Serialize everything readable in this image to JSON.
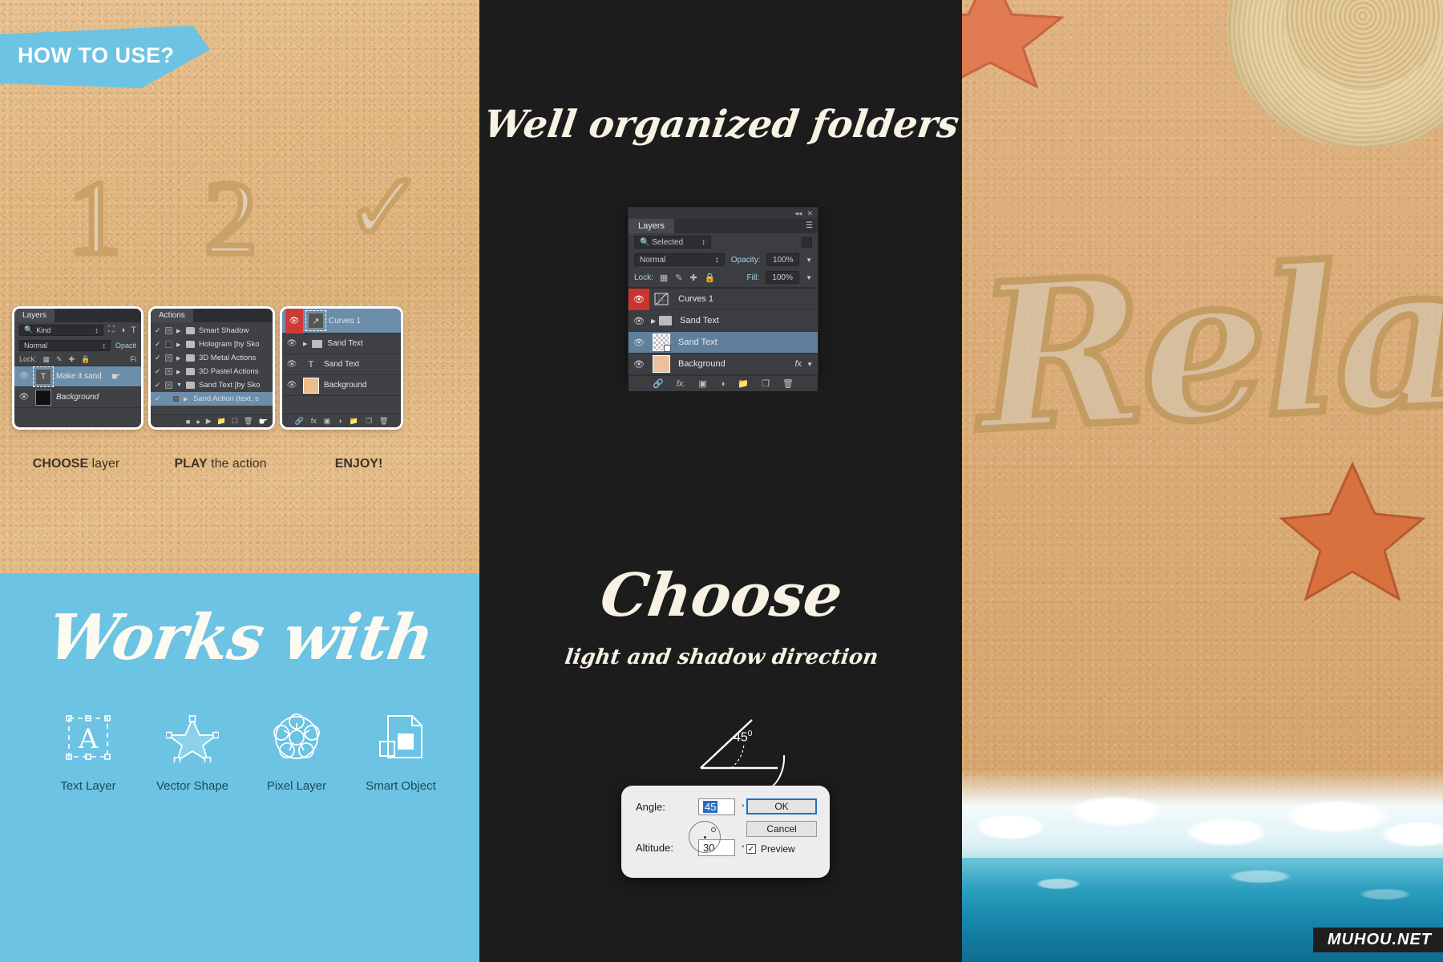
{
  "left_panel": {
    "ribbon_label": "HOW TO USE?",
    "sand_numerals": [
      "1",
      "2",
      "✓"
    ],
    "steps": [
      {
        "bold": "CHOOSE",
        "rest": " layer"
      },
      {
        "bold": "PLAY",
        "rest": " the action"
      },
      {
        "bold": "ENJOY!",
        "rest": ""
      }
    ],
    "panel_choose": {
      "tab": "Layers",
      "filter_value": "Kind",
      "filter_icon": "search-icon",
      "kind_icons": [
        "image-icon",
        "adjustment-icon",
        "type-icon"
      ],
      "blend_mode": "Normal",
      "opacity_label": "Opacit",
      "lock_label": "Lock:",
      "fill_label": "Fi",
      "layers": [
        {
          "name": "Make it sand",
          "thumb": "T",
          "selected": true,
          "visible": true
        },
        {
          "name": "Background",
          "thumb": "bg",
          "selected": false,
          "visible": true
        }
      ],
      "cursor": "hand-cursor"
    },
    "panel_play": {
      "tab": "Actions",
      "rows": [
        {
          "name": "Smart Shadow",
          "checked": true,
          "box": "dialog",
          "expanded": false,
          "selected": false
        },
        {
          "name": "Hologram [by Sko",
          "checked": true,
          "box": "empty",
          "expanded": false,
          "selected": false
        },
        {
          "name": "3D Metal Actions",
          "checked": true,
          "box": "dialog",
          "expanded": false,
          "selected": false
        },
        {
          "name": "3D Pastel Actions",
          "checked": true,
          "box": "dialog",
          "expanded": false,
          "selected": false
        },
        {
          "name": "Sand Text [by Sko",
          "checked": true,
          "box": "dialog",
          "expanded": true,
          "selected": false
        },
        {
          "name": "Sand Action (text, s",
          "checked": true,
          "box": "dialog",
          "expanded": false,
          "selected": true
        }
      ],
      "footer_icons": [
        "stop-icon",
        "record-icon",
        "play-icon",
        "new-folder-icon",
        "new-action-icon",
        "delete-icon"
      ],
      "cursor": "hand-cursor"
    },
    "panel_enjoy": {
      "layers": [
        {
          "name": "Curves 1",
          "thumb": "curves-icon",
          "selected": true,
          "visible": true,
          "eye_red": true
        },
        {
          "name": "Sand Text",
          "thumb": "folder-icon",
          "selected": false,
          "visible": true,
          "eye_red": false
        },
        {
          "name": "Sand Text",
          "thumb": "T",
          "selected": false,
          "visible": true,
          "eye_red": false
        },
        {
          "name": "Background",
          "thumb": "bg",
          "selected": false,
          "visible": true,
          "eye_red": false
        }
      ],
      "footer_icons": [
        "link-icon",
        "fx-icon",
        "mask-icon",
        "adjustment-icon",
        "new-group-icon",
        "new-layer-icon",
        "delete-icon"
      ]
    },
    "works_with": {
      "title": "Works with",
      "items": [
        {
          "icon": "text-layer-icon",
          "label": "Text Layer"
        },
        {
          "icon": "vector-shape-icon",
          "label": "Vector Shape"
        },
        {
          "icon": "pixel-layer-icon",
          "label": "Pixel Layer"
        },
        {
          "icon": "smart-object-icon",
          "label": "Smart Object"
        }
      ]
    }
  },
  "mid_panel": {
    "heading_folders": "Well organized folders",
    "heading_choose": "Choose",
    "subheading_choose": "light and shadow direction",
    "layers_panel": {
      "collapse_icon": "collapse-icon",
      "close_icon": "close-icon",
      "tab": "Layers",
      "menu_icon": "panel-menu-icon",
      "filter_value": "Selected",
      "filter_icon": "search-icon",
      "blend_mode": "Normal",
      "opacity_label": "Opacity:",
      "opacity_value": "100%",
      "lock_label": "Lock:",
      "fill_label": "Fill:",
      "fill_value": "100%",
      "lock_icons": [
        "lock-transparency-icon",
        "lock-image-icon",
        "lock-position-icon",
        "lock-all-icon"
      ],
      "layers": [
        {
          "name": "Curves 1",
          "thumb": "curves-icon",
          "selected": false,
          "eye_red": true,
          "fx": ""
        },
        {
          "name": "Sand Text",
          "thumb": "folder-icon",
          "selected": false,
          "eye_red": false,
          "fx": ""
        },
        {
          "name": "Sand Text",
          "thumb": "smart-object-thumb",
          "selected": true,
          "eye_red": false,
          "fx": ""
        },
        {
          "name": "Background",
          "thumb": "background-thumb",
          "selected": false,
          "eye_red": false,
          "fx": "fx"
        }
      ],
      "footer_icons": [
        "link-icon",
        "fx-icon",
        "mask-icon",
        "adjustment-icon",
        "new-group-icon",
        "new-layer-icon",
        "delete-icon"
      ]
    },
    "angle_diagram": {
      "label": "45",
      "degree_symbol": "0",
      "arrow_icon": "curved-arrow-icon"
    },
    "angle_dialog": {
      "angle_label": "Angle:",
      "angle_value": "45",
      "angle_unit": "°",
      "altitude_label": "Altitude:",
      "altitude_value": "30",
      "altitude_unit": "°",
      "ok_label": "OK",
      "cancel_label": "Cancel",
      "preview_label": "Preview",
      "preview_checked": true,
      "dial_icon": "angle-dial"
    }
  },
  "right_panel": {
    "sand_word": "Relax",
    "watermark": "MUHOU.NET",
    "objects": [
      "starfish-top-left",
      "straw-hat",
      "starfish-right",
      "sea-foam",
      "ocean-water"
    ]
  },
  "colors": {
    "accent_blue": "#6cc3e3",
    "dark_bg": "#1c1c1c",
    "sand": "#ddb17a",
    "ps_panel": "#3b3d41",
    "ps_selection": "#5f7f9d",
    "red_eye": "#c9352f",
    "dialog_blue": "#1a73c9",
    "ocean": "#1786aa"
  }
}
